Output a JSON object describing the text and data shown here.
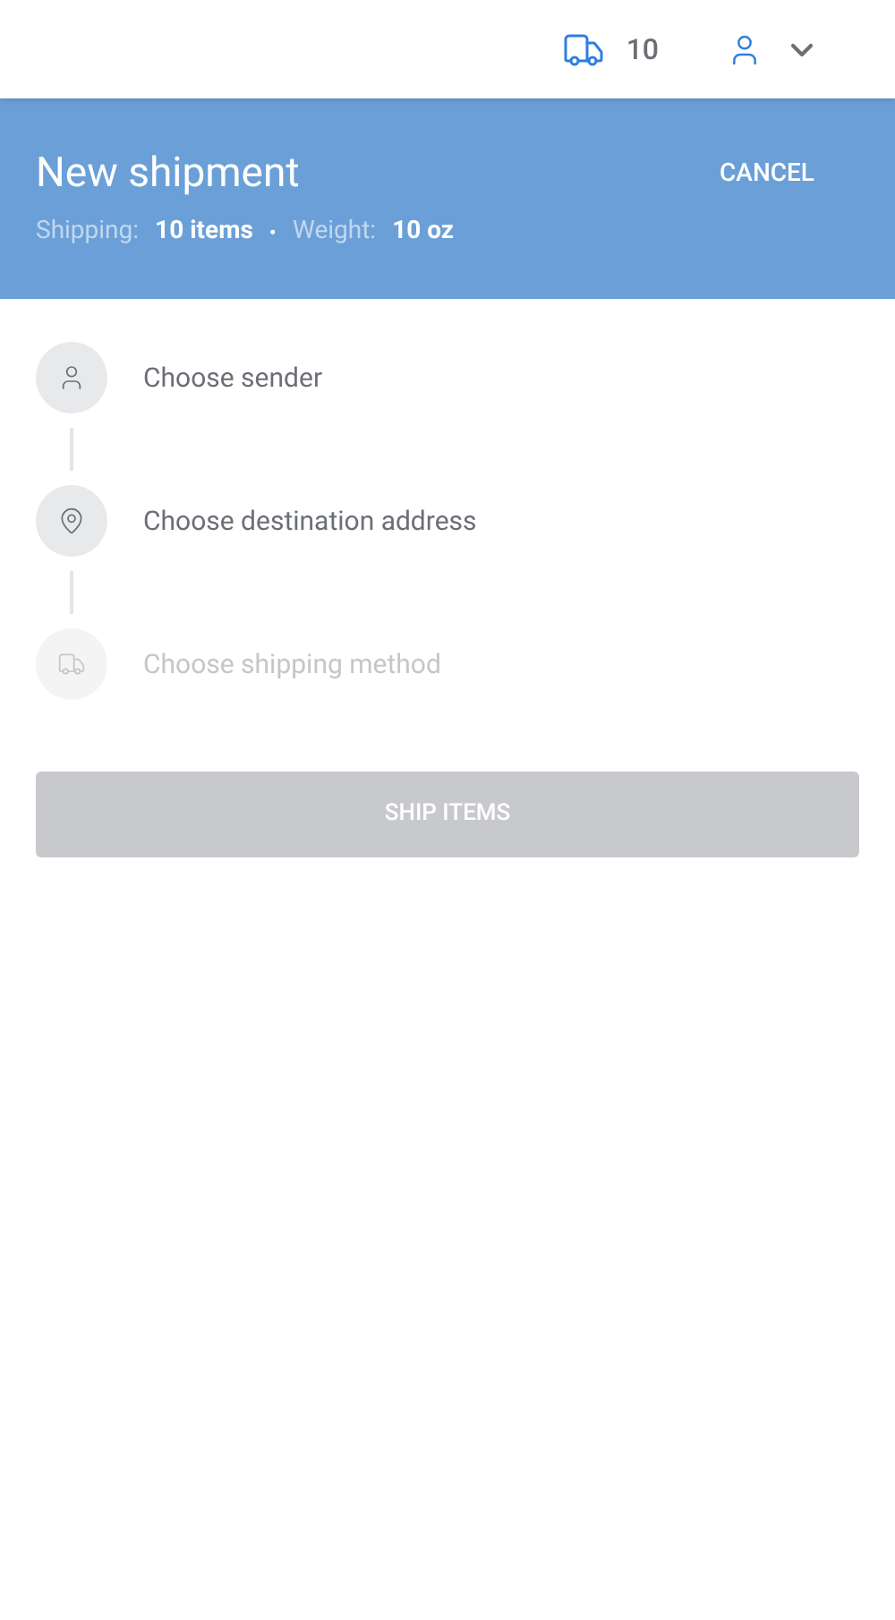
{
  "top_bar": {
    "shipment_count": "10"
  },
  "header": {
    "title": "New shipment",
    "cancel": "CANCEL",
    "shipping_label": "Shipping:",
    "shipping_value": "10 items",
    "separator": "•",
    "weight_label": "Weight:",
    "weight_value": "10 oz"
  },
  "steps": [
    {
      "kind": "person",
      "label": "Choose sender",
      "disabled": false
    },
    {
      "kind": "pin",
      "label": "Choose destination address",
      "disabled": false
    },
    {
      "kind": "truck",
      "label": "Choose shipping method",
      "disabled": true
    }
  ],
  "ship_button": {
    "label": "SHIP ITEMS",
    "disabled": true
  }
}
